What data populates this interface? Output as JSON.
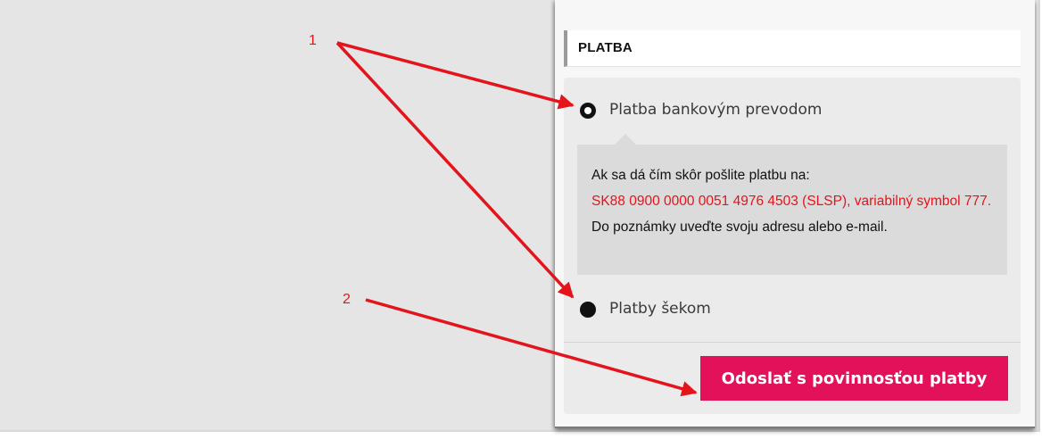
{
  "annotations": {
    "marker_1": "1",
    "marker_2": "2"
  },
  "payment_section": {
    "title": "PLATBA",
    "options": [
      {
        "label": "Platba bankovým prevodom",
        "selected": true
      },
      {
        "label": "Platby šekom",
        "selected": false
      }
    ],
    "bank_info": {
      "line_1": "Ak sa dá čím skôr pošlite platbu na:",
      "line_2": "SK88 0900 0000 0051 4976 4503 (SLSP), variabilný symbol 777.",
      "line_3": "Do poznámky uveďte svoju adresu alebo e-mail."
    },
    "submit_label": "Odoslať s povinnosťou platby"
  },
  "colors": {
    "accent": "#e21159",
    "annotation": "#e3141b",
    "background": "#e6e5e5"
  }
}
